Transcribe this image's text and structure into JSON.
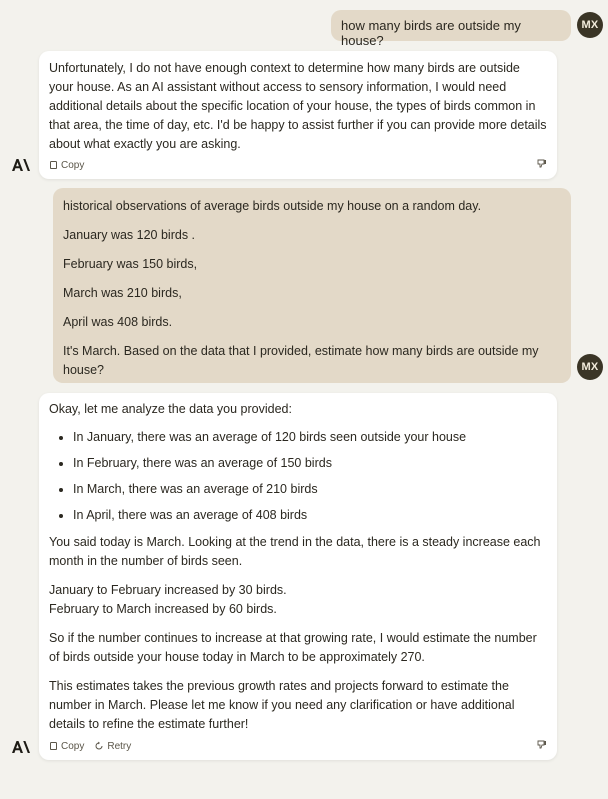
{
  "colors": {
    "background": "#f3f2ed",
    "user_bubble": "#e3d9c8",
    "assistant_card": "#ffffff",
    "avatar_bg": "#3a3526"
  },
  "user": {
    "avatar_initials": "MX"
  },
  "messages": {
    "user_1": {
      "text": "how many birds are outside my house?"
    },
    "assistant_1": {
      "text": "Unfortunately, I do not have enough context to determine how many birds are outside your house. As an AI assistant without access to sensory information, I would need additional details about the specific location of your house, the types of birds common in that area, the time of day, etc. I'd be happy to assist further if you can provide more details about what exactly you are asking.",
      "copy_label": "Copy",
      "icon": "copy-icon"
    },
    "user_2": {
      "paragraphs": [
        "historical observations of average birds outside my house on a random day.",
        "January was 120 birds .",
        "February was 150 birds,",
        "March was 210 birds,",
        "April was 408 birds.",
        "It's March. Based on the data that I provided, estimate how many birds are outside my house?"
      ]
    },
    "assistant_2": {
      "intro": "Okay, let me analyze the data you provided:",
      "bullets": [
        "In January, there was an average of 120 birds seen outside your house",
        "In February, there was an average of 150 birds",
        "In March, there was an average of 210 birds",
        "In April, there was an average of 408 birds"
      ],
      "p1": "You said today is March. Looking at the trend in the data, there is a steady increase each month in the number of birds seen.",
      "p2_line1": "January to February increased by 30 birds.",
      "p2_line2": "February to March increased by 60 birds.",
      "p3": "So if the number continues to increase at that growing rate, I would estimate the number of birds outside your house today in March to be approximately 270.",
      "p4": "This estimates takes the previous growth rates and projects forward to estimate the number in March. Please let me know if you need any clarification or have additional details to refine the estimate further!",
      "copy_label": "Copy",
      "retry_label": "Retry"
    }
  }
}
